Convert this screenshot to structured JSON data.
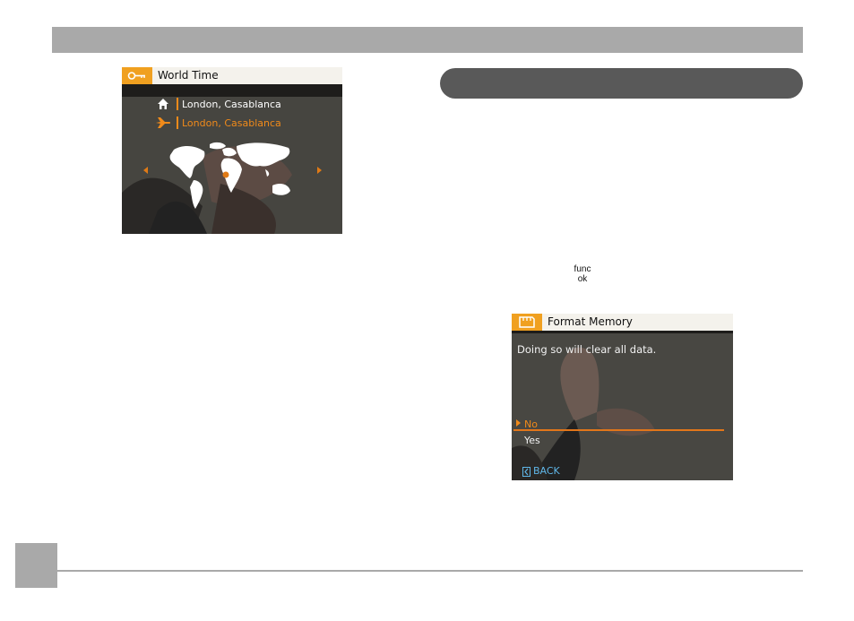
{
  "world_time": {
    "title": "World Time",
    "home_city": "London, Casablanca",
    "travel_city": "London, Casablanca",
    "home_color": "#ffffff",
    "travel_color": "#f08a1a"
  },
  "function_key": {
    "line1": "func",
    "line2": "ok"
  },
  "format_memory": {
    "title": "Format Memory",
    "message": "Doing so will clear all data.",
    "options": [
      "No",
      "Yes"
    ],
    "selected_option": "No",
    "back_label": "BACK",
    "accent_color": "#e2761a"
  }
}
